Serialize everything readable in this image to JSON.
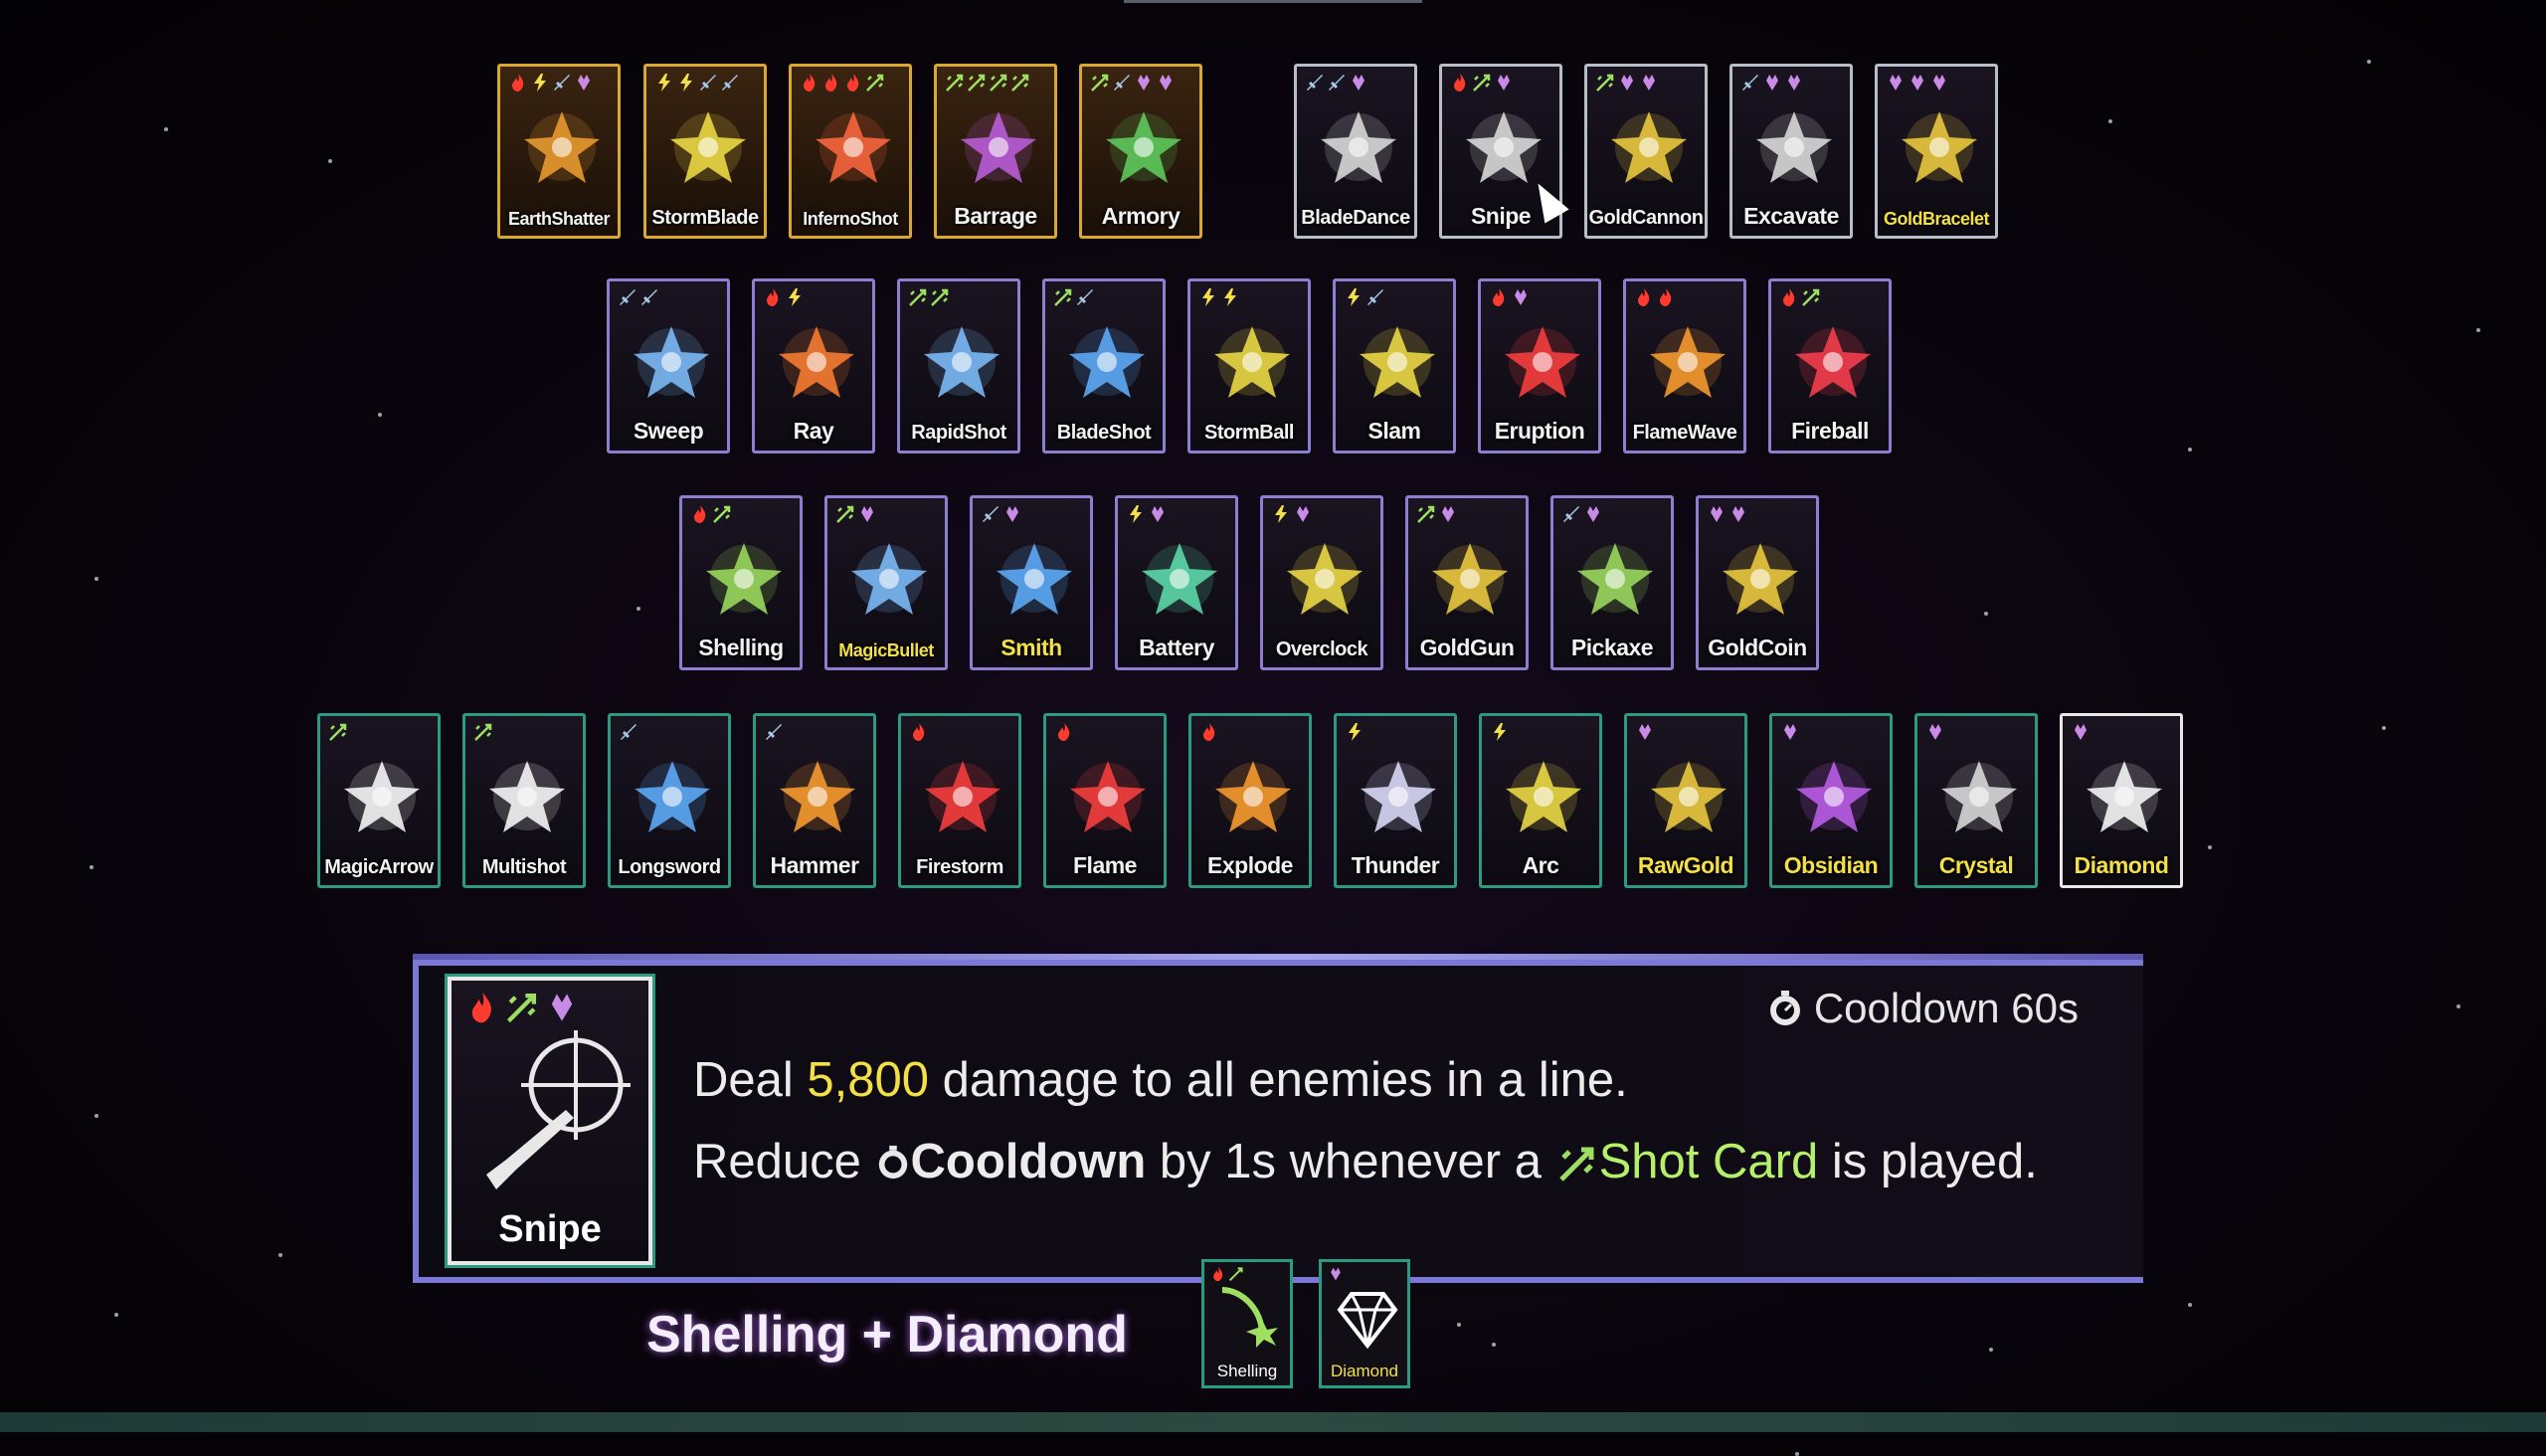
{
  "colors": {
    "gold_border": "#d9a830",
    "teal_border": "#2a9a80",
    "silver_border": "#b7bec7",
    "accent_yellow": "#f3e046",
    "accent_green": "#b6f06a",
    "panel_border": "#7c78d6"
  },
  "rows": [
    [
      {
        "name": "EarthShatter",
        "frame": "gold",
        "icon": "earthshatter-icon",
        "syms": [
          "fire",
          "lightning",
          "sword",
          "gem"
        ],
        "color": "#f0a030"
      },
      {
        "name": "StormBlade",
        "frame": "gold",
        "icon": "stormblade-icon",
        "syms": [
          "lightning",
          "lightning",
          "sword",
          "sword"
        ],
        "color": "#f3e046"
      },
      {
        "name": "InfernoShot",
        "frame": "gold",
        "icon": "infernoshot-icon",
        "syms": [
          "fire",
          "fire",
          "fire",
          "shot"
        ],
        "color": "#ff6a40"
      },
      {
        "name": "Barrage",
        "frame": "gold",
        "icon": "barrage-icon",
        "syms": [
          "shot",
          "shot",
          "shot",
          "shot"
        ],
        "color": "#c060e0"
      },
      {
        "name": "Armory",
        "frame": "gold",
        "icon": "armory-icon",
        "syms": [
          "shot",
          "sword",
          "gem",
          "gem"
        ],
        "color": "#60d060"
      },
      {
        "name": "BladeDance",
        "frame": "silver",
        "icon": "bladedance-icon",
        "syms": [
          "sword",
          "sword",
          "gem"
        ],
        "color": "#e0e0e0"
      },
      {
        "name": "Snipe",
        "frame": "silver",
        "icon": "snipe-icon",
        "syms": [
          "fire",
          "shot",
          "gem"
        ],
        "color": "#e0e0e0"
      },
      {
        "name": "GoldCannon",
        "frame": "silver",
        "icon": "goldcannon-icon",
        "syms": [
          "shot",
          "gem",
          "gem"
        ],
        "color": "#f3d040"
      },
      {
        "name": "Excavate",
        "frame": "silver",
        "icon": "excavate-icon",
        "syms": [
          "sword",
          "gem",
          "gem"
        ],
        "color": "#e0e0e0"
      },
      {
        "name": "GoldBracelet",
        "frame": "silver",
        "icon": "goldbracelet-icon",
        "syms": [
          "gem",
          "gem",
          "gem"
        ],
        "color": "#f3d040",
        "label_color": "yellow"
      }
    ],
    [
      {
        "name": "Sweep",
        "frame": "violet",
        "icon": "sweep-icon",
        "syms": [
          "sword",
          "sword"
        ],
        "color": "#80c0ff"
      },
      {
        "name": "Ray",
        "frame": "violet",
        "icon": "ray-icon",
        "syms": [
          "fire",
          "lightning"
        ],
        "color": "#ff8030"
      },
      {
        "name": "RapidShot",
        "frame": "violet",
        "icon": "rapidshot-icon",
        "syms": [
          "shot",
          "shot"
        ],
        "color": "#80c0ff"
      },
      {
        "name": "BladeShot",
        "frame": "violet",
        "icon": "bladeshot-icon",
        "syms": [
          "shot",
          "sword"
        ],
        "color": "#60b0ff"
      },
      {
        "name": "StormBall",
        "frame": "violet",
        "icon": "stormball-icon",
        "syms": [
          "lightning",
          "lightning"
        ],
        "color": "#f3e046"
      },
      {
        "name": "Slam",
        "frame": "violet",
        "icon": "slam-icon",
        "syms": [
          "lightning",
          "sword"
        ],
        "color": "#f3e046"
      },
      {
        "name": "Eruption",
        "frame": "violet",
        "icon": "eruption-icon",
        "syms": [
          "fire",
          "gem"
        ],
        "color": "#ff4040"
      },
      {
        "name": "FlameWave",
        "frame": "violet",
        "icon": "flamewave-icon",
        "syms": [
          "fire",
          "fire"
        ],
        "color": "#ffa030"
      },
      {
        "name": "Fireball",
        "frame": "violet",
        "icon": "fireball-icon",
        "syms": [
          "fire",
          "shot"
        ],
        "color": "#ff4050"
      }
    ],
    [
      {
        "name": "Shelling",
        "frame": "violet",
        "icon": "shelling-icon",
        "syms": [
          "fire",
          "shot"
        ],
        "color": "#a0e060"
      },
      {
        "name": "MagicBullet",
        "frame": "violet",
        "icon": "magicbullet-icon",
        "syms": [
          "shot",
          "gem"
        ],
        "color": "#80c0ff",
        "label_color": "yellow"
      },
      {
        "name": "Smith",
        "frame": "violet",
        "icon": "smith-icon",
        "syms": [
          "sword",
          "gem"
        ],
        "color": "#60b0ff",
        "label_color": "yellow"
      },
      {
        "name": "Battery",
        "frame": "violet",
        "icon": "battery-icon",
        "syms": [
          "lightning",
          "gem"
        ],
        "color": "#60e0b0"
      },
      {
        "name": "Overclock",
        "frame": "violet",
        "icon": "overclock-icon",
        "syms": [
          "lightning",
          "gem"
        ],
        "color": "#f3e046"
      },
      {
        "name": "GoldGun",
        "frame": "violet",
        "icon": "goldgun-icon",
        "syms": [
          "shot",
          "gem"
        ],
        "color": "#f3d040"
      },
      {
        "name": "Pickaxe",
        "frame": "violet",
        "icon": "pickaxe-icon",
        "syms": [
          "sword",
          "gem"
        ],
        "color": "#a0e060"
      },
      {
        "name": "GoldCoin",
        "frame": "violet",
        "icon": "goldcoin-icon",
        "syms": [
          "gem",
          "gem"
        ],
        "color": "#f3d040"
      }
    ],
    [
      {
        "name": "MagicArrow",
        "frame": "teal",
        "icon": "magicarrow-icon",
        "syms": [
          "shot"
        ],
        "color": "#ffffff"
      },
      {
        "name": "Multishot",
        "frame": "teal",
        "icon": "multishot-icon",
        "syms": [
          "shot"
        ],
        "color": "#ffffff"
      },
      {
        "name": "Longsword",
        "frame": "teal",
        "icon": "longsword-icon",
        "syms": [
          "sword"
        ],
        "color": "#60b0ff"
      },
      {
        "name": "Hammer",
        "frame": "teal",
        "icon": "hammer-icon",
        "syms": [
          "sword"
        ],
        "color": "#ffa030"
      },
      {
        "name": "Firestorm",
        "frame": "teal",
        "icon": "firestorm-icon",
        "syms": [
          "fire"
        ],
        "color": "#ff4040"
      },
      {
        "name": "Flame",
        "frame": "teal",
        "icon": "flame-icon",
        "syms": [
          "fire"
        ],
        "color": "#ff4040"
      },
      {
        "name": "Explode",
        "frame": "teal",
        "icon": "explode-icon",
        "syms": [
          "fire"
        ],
        "color": "#ffa030"
      },
      {
        "name": "Thunder",
        "frame": "teal",
        "icon": "thunder-icon",
        "syms": [
          "lightning"
        ],
        "color": "#e0e0ff"
      },
      {
        "name": "Arc",
        "frame": "teal",
        "icon": "arc-icon",
        "syms": [
          "lightning"
        ],
        "color": "#f3e046"
      },
      {
        "name": "RawGold",
        "frame": "teal",
        "icon": "rawgold-icon",
        "syms": [
          "gem"
        ],
        "color": "#f3d040",
        "label_color": "yellow"
      },
      {
        "name": "Obsidian",
        "frame": "teal",
        "icon": "obsidian-icon",
        "syms": [
          "gem"
        ],
        "color": "#c060f0",
        "label_color": "yellow"
      },
      {
        "name": "Crystal",
        "frame": "teal",
        "icon": "crystal-icon",
        "syms": [
          "gem"
        ],
        "color": "#e0e0e0",
        "label_color": "yellow"
      },
      {
        "name": "Diamond",
        "frame": "white",
        "icon": "diamond-icon",
        "syms": [
          "gem"
        ],
        "color": "#ffffff",
        "label_color": "yellow"
      }
    ]
  ],
  "detail": {
    "card_name": "Snipe",
    "cooldown_label": "Cooldown 60s",
    "line1_prefix": "Deal ",
    "line1_number": "5,800",
    "line1_suffix": " damage to all enemies in a line.",
    "line2_prefix": "Reduce ",
    "line2_keyword": "Cooldown",
    "line2_middle": " by 1s whenever a ",
    "line2_card": "Shot Card",
    "line2_suffix": " is played."
  },
  "combo": {
    "title": "Shelling + Diamond",
    "card1": "Shelling",
    "card2": "Diamond"
  }
}
